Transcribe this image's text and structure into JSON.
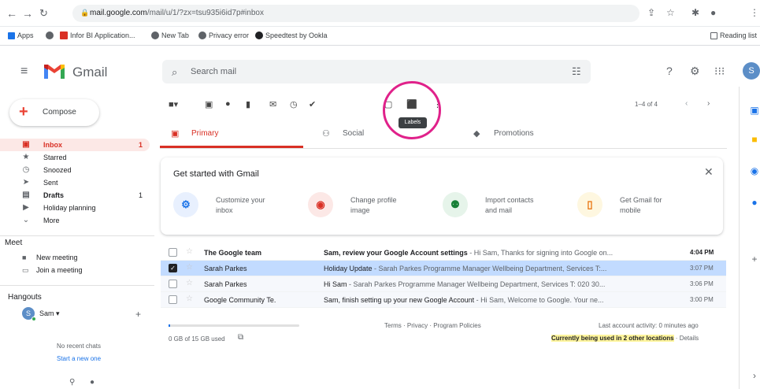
{
  "browser": {
    "url_host": "mail.google.com",
    "url_path": "/mail/u/1/?zx=tsu935i6id7p#inbox",
    "bookmarks": [
      "Apps",
      "Infor BI Application...",
      "New Tab",
      "Privacy error",
      "Speedtest by Ookla"
    ],
    "reading_list": "Reading list"
  },
  "header": {
    "app_name": "Gmail",
    "search_placeholder": "Search mail",
    "avatar_letter": "S"
  },
  "sidebar": {
    "compose_label": "Compose",
    "items": [
      {
        "label": "Inbox",
        "count": "1",
        "icon": "inbox-icon"
      },
      {
        "label": "Starred",
        "count": "",
        "icon": "star-icon"
      },
      {
        "label": "Snoozed",
        "count": "",
        "icon": "clock-icon"
      },
      {
        "label": "Sent",
        "count": "",
        "icon": "send-icon"
      },
      {
        "label": "Drafts",
        "count": "1",
        "icon": "draft-icon"
      },
      {
        "label": "Holiday planning",
        "count": "",
        "icon": "label-icon"
      },
      {
        "label": "More",
        "count": "",
        "icon": "chevron-down-icon"
      }
    ],
    "meet_header": "Meet",
    "meet_items": [
      "New meeting",
      "Join a meeting"
    ],
    "hangouts_header": "Hangouts",
    "hangouts_user": "Sam",
    "hangouts_avatar": "S",
    "no_chats": "No recent chats",
    "start_new": "Start a new one"
  },
  "toolbar": {
    "pager": "1–4 of 4",
    "tooltip": "Labels"
  },
  "tabs": [
    {
      "label": "Primary",
      "icon": "inbox-icon",
      "active": true
    },
    {
      "label": "Social",
      "icon": "people-icon",
      "active": false
    },
    {
      "label": "Promotions",
      "icon": "tag-icon",
      "active": false
    }
  ],
  "getting_started": {
    "title": "Get started with Gmail",
    "features": [
      {
        "line1": "Customize your",
        "line2": "inbox",
        "icon": "gear-icon",
        "color": "#1a73e8",
        "bg": "#e8f0fe"
      },
      {
        "line1": "Change profile",
        "line2": "image",
        "icon": "account-icon",
        "color": "#d93025",
        "bg": "#fce8e6"
      },
      {
        "line1": "Import contacts",
        "line2": "and mail",
        "icon": "add-contacts-icon",
        "color": "#188038",
        "bg": "#e6f4ea"
      },
      {
        "line1": "Get Gmail for",
        "line2": "mobile",
        "icon": "mobile-icon",
        "color": "#e8710a",
        "bg": "#fef7e0"
      }
    ]
  },
  "emails": [
    {
      "sender": "The Google team",
      "subject": "Sam, review your Google Account settings",
      "preview": " - Hi Sam, Thanks for signing into Google on...",
      "time": "4:04 PM",
      "unread": true,
      "selected": false
    },
    {
      "sender": "Sarah Parkes",
      "subject": "Holiday Update",
      "preview": " - Sarah Parkes Programme Manager Wellbeing Department, Services T:...",
      "time": "3:07 PM",
      "unread": false,
      "selected": true
    },
    {
      "sender": "Sarah Parkes",
      "subject": "Hi Sam",
      "preview": " - Sarah Parkes Programme Manager Wellbeing Department, Services T: 020 30...",
      "time": "3:06 PM",
      "unread": false,
      "selected": false
    },
    {
      "sender": "Google Community Te.",
      "subject": "Sam, finish setting up your new Google Account",
      "preview": " - Hi Sam, Welcome to Google. Your ne...",
      "time": "3:00 PM",
      "unread": false,
      "selected": false
    }
  ],
  "footer": {
    "storage": "0 GB of 15 GB used",
    "storage_fraction": 0.01,
    "links": "Terms · Privacy · Program Policies",
    "last_activity": "Last account activity: 0 minutes ago",
    "locations_highlight": "Currently being used in 2 other locations",
    "details": " · Details"
  }
}
